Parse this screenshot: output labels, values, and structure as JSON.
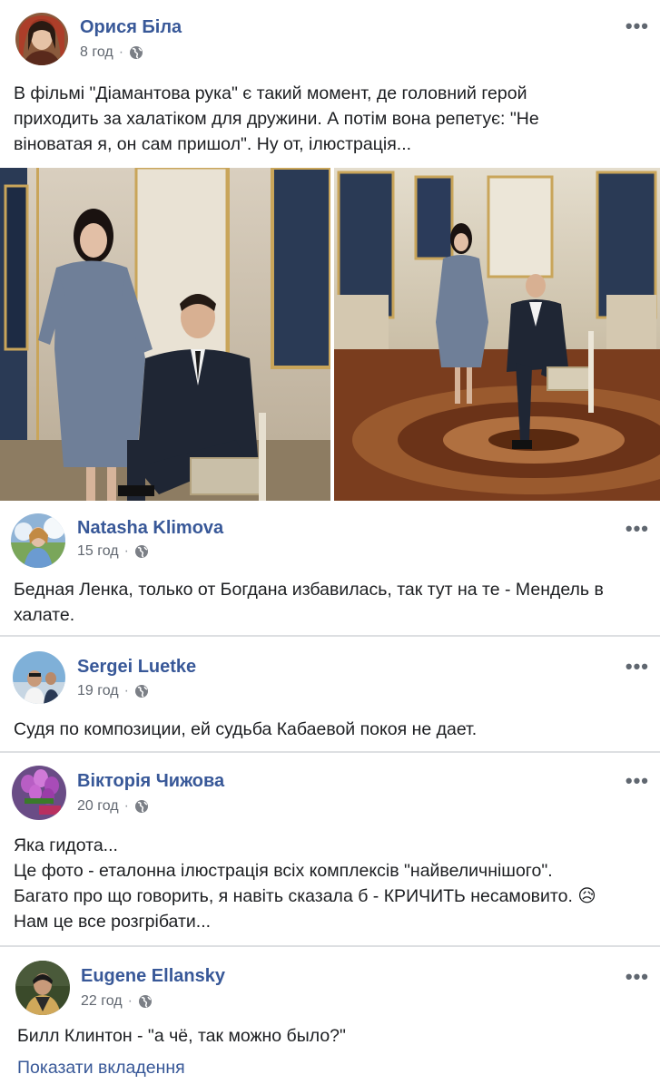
{
  "post": {
    "author": "Орися Біла",
    "time": "8 год",
    "text_lines": [
      "В фільмі \"Діамантова рука\" є такий момент, де головний герой",
      "приходить за халатіком для дружини. А потім вона репетує: \"Не",
      "віноватая я, он сам пришол\". Ну от, ілюстрація..."
    ]
  },
  "comments": [
    {
      "author": "Natasha Klimova",
      "time": "15 год",
      "lines": [
        "Бедная Ленка, только от Богдана избавилась, так тут на те - Мендель в",
        "халате."
      ]
    },
    {
      "author": "Sergei Luetke",
      "time": "19 год",
      "lines": [
        "Судя по композиции, ей судьба Кабаевой покоя не дает."
      ]
    },
    {
      "author": "Вікторія Чижова",
      "time": "20 год",
      "lines": [
        "Яка гидота...",
        "Це фото - еталонна ілюстрація всіх комплексів \"найвеличнішого\".",
        "Багато про що говорить, я навіть сказала б - КРИЧИТЬ несамовито. 😥",
        "Нам це все розгрібати..."
      ]
    },
    {
      "author": "Eugene Ellansky",
      "time": "22 год",
      "lines": [
        "Билл Клинтон - \"а чё, так можно было?\""
      ],
      "link": "Показати вкладення"
    }
  ],
  "icons": {
    "more": "more-options-icon",
    "privacy": "globe-icon"
  },
  "colors": {
    "author": "#385898",
    "meta": "#616770",
    "text": "#1c1e21"
  }
}
